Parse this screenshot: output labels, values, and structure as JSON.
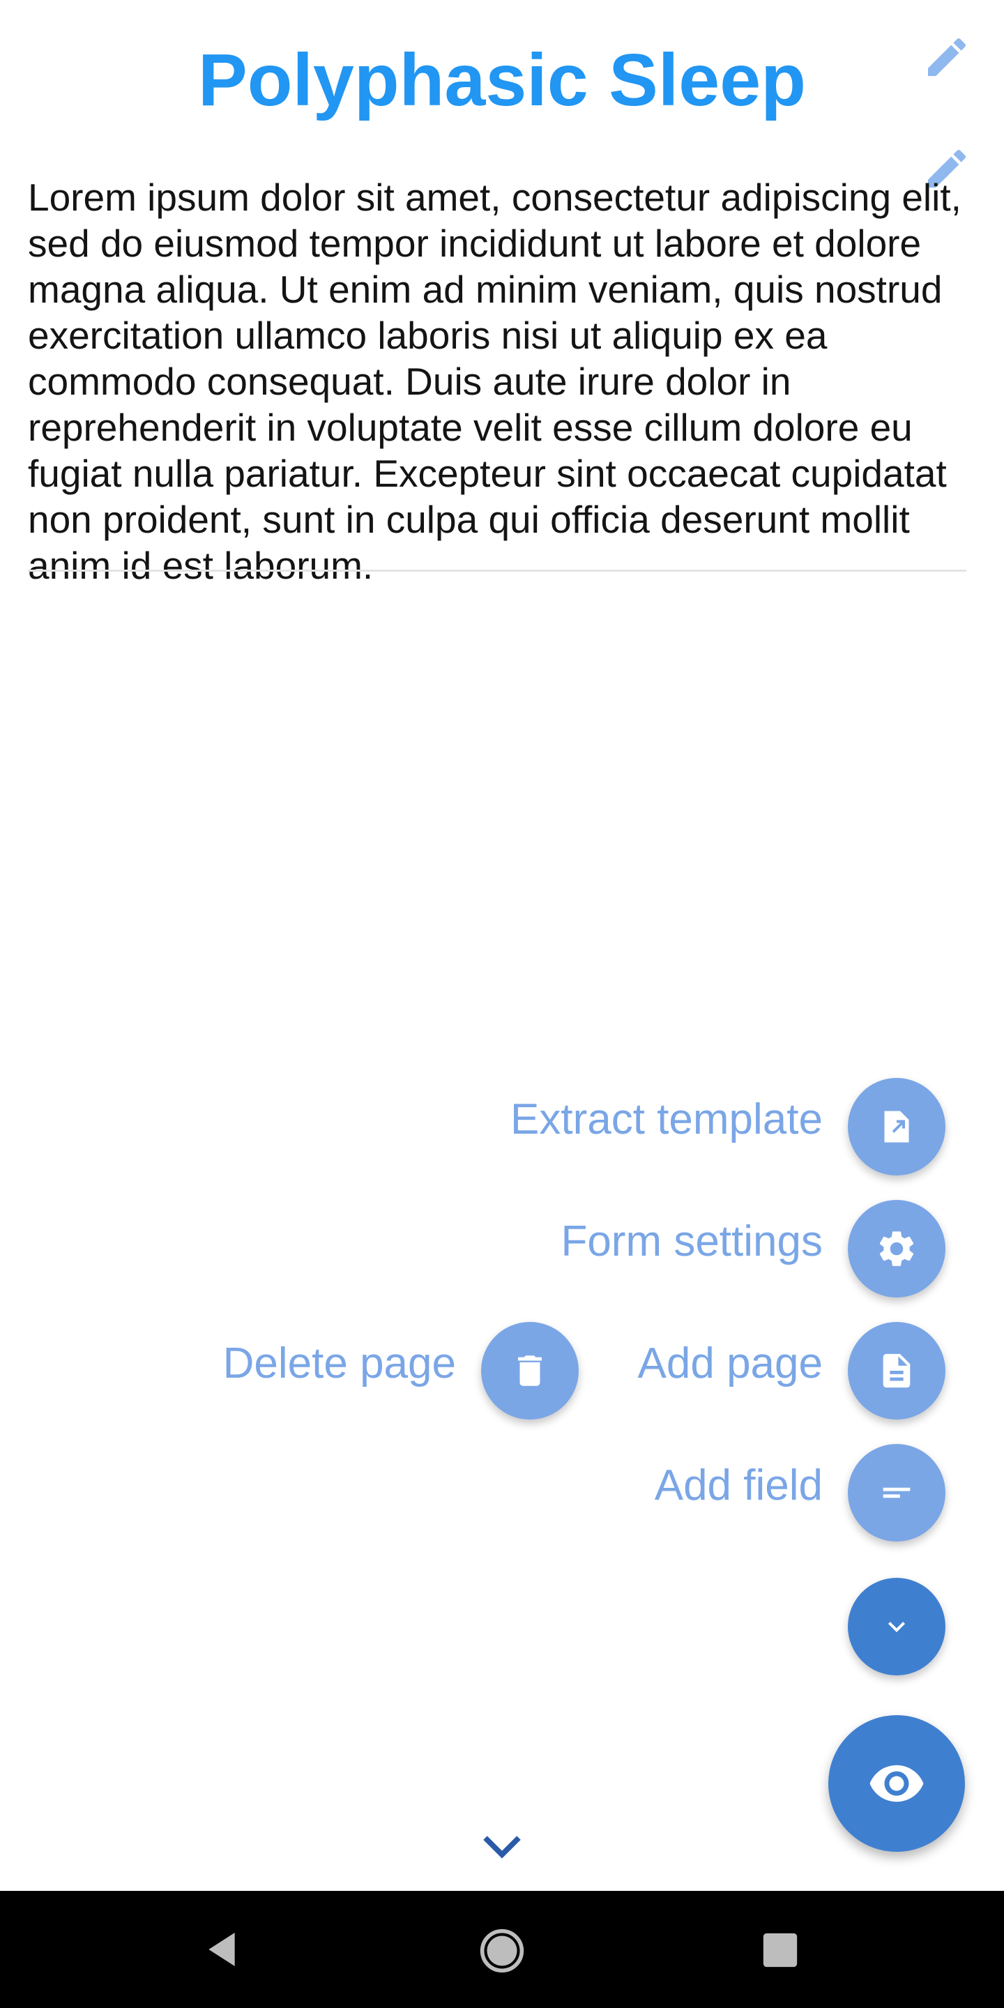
{
  "header": {
    "title": "Polyphasic Sleep"
  },
  "description": "Lorem ipsum dolor sit amet, consectetur adipiscing elit, sed do eiusmod tempor incididunt ut labore et dolore magna aliqua. Ut enim ad minim veniam, quis nostrud exercitation ullamco laboris nisi ut aliquip ex ea commodo consequat. Duis aute irure dolor in reprehenderit in voluptate velit esse cillum dolore eu fugiat nulla pariatur. Excepteur sint occaecat cupidatat non proident, sunt in culpa qui officia deserunt mollit anim id est laborum.",
  "fab_menu": {
    "extract_template": "Extract template",
    "form_settings": "Form settings",
    "add_page": "Add page",
    "delete_page": "Delete page",
    "add_field": "Add field"
  },
  "icons": {
    "edit_title": "pencil-icon",
    "edit_description": "pencil-icon",
    "extract_template": "extract-template-icon",
    "form_settings": "gear-icon",
    "add_page": "document-icon",
    "delete_page": "trash-icon",
    "add_field": "short-text-icon",
    "collapse": "chevron-down-icon",
    "preview": "eye-icon",
    "page_nav": "chevron-down-icon",
    "nav_back": "back-triangle-icon",
    "nav_home": "home-circle-icon",
    "nav_recents": "recents-square-icon"
  },
  "colors": {
    "title": "#2196f3",
    "fab_mini": "#7aa6e6",
    "fab_primary": "#3f7fd0",
    "label": "#7aa6e6",
    "navbar": "#000000"
  }
}
